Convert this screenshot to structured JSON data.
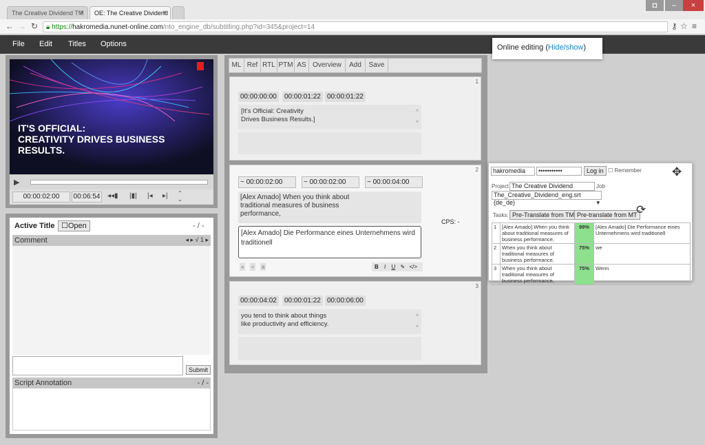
{
  "browser": {
    "tabs": [
      {
        "label": "The Creative Dividend TM"
      },
      {
        "label": "OE: The Creative Dividend"
      }
    ],
    "url_scheme": "https://",
    "url_host": "hakromedia.nunet-online.com",
    "url_path": "/nto_engine_db/subtitling.php?id=345&project=14"
  },
  "menu": [
    "File",
    "Edit",
    "Titles",
    "Options"
  ],
  "popup": {
    "text": "Online editing (",
    "link": "Hide/show",
    "tail": ")"
  },
  "video": {
    "headline1": "IT'S OFFICIAL:",
    "headline2": "CREATIVITY DRIVES BUSINESS RESULTS.",
    "time_current": "00:00:02:00",
    "time_total": "00:06:54"
  },
  "title_panel": {
    "title": "Active Title",
    "open_label": "Open",
    "nav": "- / -",
    "comment_label": "Comment",
    "comment_nav": "1",
    "submit": "Submit",
    "annotation_label": "Script Annotation",
    "annotation_nav": "- / -"
  },
  "editor": {
    "tabs": [
      "ML",
      "Ref",
      "RTL",
      "PTM",
      "AS",
      "Overview",
      "Add",
      "Save"
    ],
    "cps_label": "CPS:",
    "cps_value": "-",
    "cards": [
      {
        "num": "1",
        "tin": "00:00:00:00",
        "tout": "00:00:01:22",
        "dur": "00:00:01:22",
        "line1": "[It's Official: Creativity",
        "line2": "Drives Business Results.]"
      },
      {
        "num": "2",
        "tin": "00:00:02:00",
        "tout": "00:00:02:00",
        "dur": "00:00:04:00",
        "src1": "[Alex Amado] When you think about",
        "src2": "traditional measures of business",
        "src3": "performance,",
        "target1": "[Alex Amado] Die Performance eines Unternehmens wird",
        "target2": "traditionell"
      },
      {
        "num": "3",
        "tin": "00:00:04:02",
        "tout": "00:00:01:22",
        "dur": "00:00:06:00",
        "line1": "you tend to think about things",
        "line2": "like productivity and efficiency."
      }
    ]
  },
  "tm_widget": {
    "username": "hakromedia",
    "password": "•••••••••••",
    "login": "Log in",
    "remember": "Remember",
    "project_label": "Project",
    "project": "The Creative Dividend TM/TB",
    "job_label": "Job",
    "job": "The_Creative_Dividend_eng.srt (de_de)",
    "tasks_label": "Tasks:",
    "btn_tm": "Pre-Translate from TM",
    "btn_mt": "Pre-translate from MT",
    "rows": [
      {
        "n": "1",
        "src": "[Alex Amado] When you think about traditional measures of business performance,",
        "pct": "99%",
        "tgt": "[Alex Amado] Die Performance eines Unternehmens wird traditionell"
      },
      {
        "n": "2",
        "src": "When you think about traditional measures of business performance,",
        "pct": "75%",
        "tgt": "we"
      },
      {
        "n": "3",
        "src": "When you think about traditional measures of business performance,",
        "pct": "75%",
        "tgt": "Wenn"
      }
    ]
  }
}
